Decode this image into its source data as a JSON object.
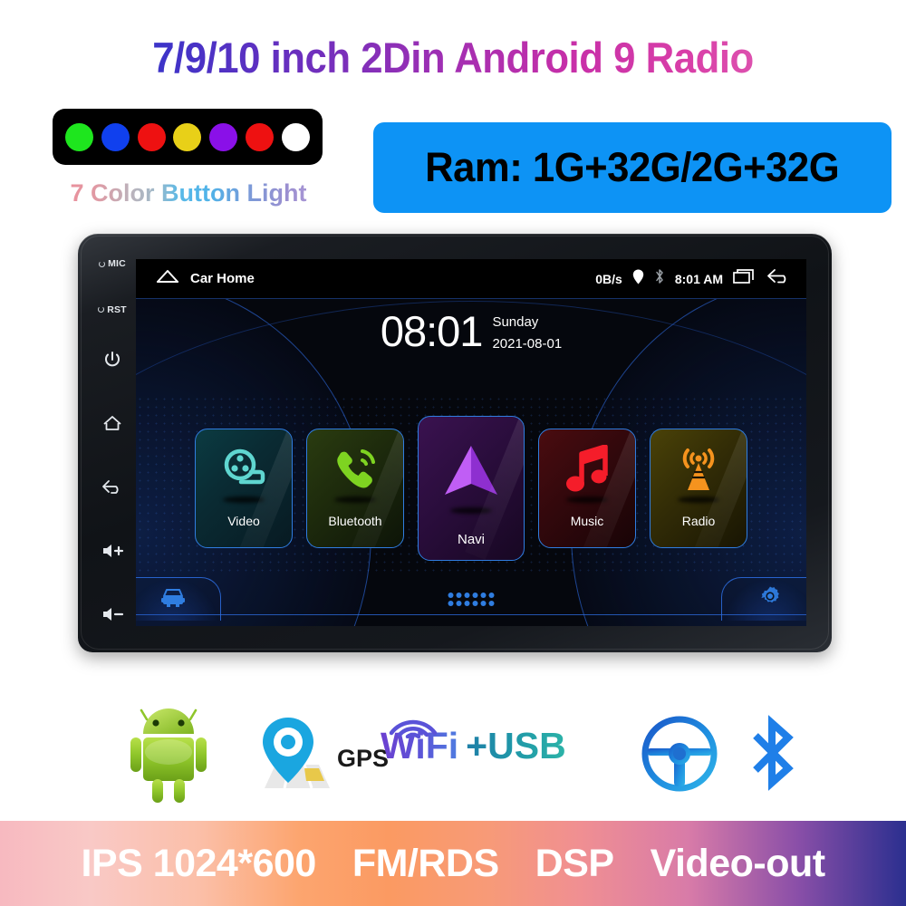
{
  "title": "7/9/10 inch 2Din Android 9 Radio",
  "light_block": {
    "caption": "7 Color Button Light",
    "dots": [
      {
        "name": "green",
        "color": "#1ee61e"
      },
      {
        "name": "blue",
        "color": "#1040ee"
      },
      {
        "name": "red",
        "color": "#ee1111"
      },
      {
        "name": "yellow",
        "color": "#e8d018"
      },
      {
        "name": "purple",
        "color": "#8a10e8"
      },
      {
        "name": "red2",
        "color": "#ee1111"
      },
      {
        "name": "white",
        "color": "#ffffff"
      }
    ]
  },
  "ram_badge": {
    "text": "Ram: 1G+32G/2G+32G",
    "bg_color": "#0d93f5",
    "text_color": "#000000"
  },
  "device": {
    "side_buttons": [
      {
        "name": "mic",
        "label": "MIC",
        "type": "label"
      },
      {
        "name": "reset",
        "label": "RST",
        "type": "label"
      },
      {
        "name": "power",
        "label": "",
        "type": "power-icon"
      },
      {
        "name": "home",
        "label": "",
        "type": "home-icon"
      },
      {
        "name": "back",
        "label": "",
        "type": "back-icon"
      },
      {
        "name": "volume-up",
        "label": "+",
        "type": "volume-icon"
      },
      {
        "name": "volume-down",
        "label": "−",
        "type": "volume-icon"
      }
    ],
    "screen": {
      "status_bar": {
        "title": "Car Home",
        "data_rate": "0B/s",
        "time": "8:01 AM"
      },
      "clock": {
        "time": "08:01",
        "weekday": "Sunday",
        "date": "2021-08-01"
      },
      "apps": [
        {
          "label": "Video",
          "icon": "film-reel-icon",
          "accent": "#5fd6d0",
          "bg": "linear-gradient(135deg,#0b3b42 0%, #0a2b33 40%, #071a22 100%)",
          "large": false
        },
        {
          "label": "Bluetooth",
          "icon": "phone-call-icon",
          "accent": "#7ed321",
          "bg": "linear-gradient(135deg,#2a3c10 0%, #1d2a0c 45%, #0d1408 100%)",
          "large": false
        },
        {
          "label": "Navi",
          "icon": "navigation-arrow-icon",
          "accent": "#b44cf0",
          "bg": "linear-gradient(135deg,#3a1250 0%, #2a0d3c 45%, #170722 100%)",
          "large": true
        },
        {
          "label": "Music",
          "icon": "music-note-icon",
          "accent": "#f51d2a",
          "bg": "linear-gradient(135deg,#4a0c10 0%, #32080c 45%, #180406 100%)",
          "large": false
        },
        {
          "label": "Radio",
          "icon": "radio-tower-icon",
          "accent": "#f5931e",
          "bg": "linear-gradient(135deg,#4a4208 0%, #322c06 45%, #181503 100%)",
          "large": false
        }
      ],
      "dock": {
        "left_icon": "car-icon",
        "center_icon": "apps-grid-icon",
        "right_icon": "gear-icon",
        "accent": "#2f7de0"
      }
    }
  },
  "features": {
    "android_icon": "android-robot-icon",
    "gps_label": "GPS",
    "gps_icon": "gps-pin-map-icon",
    "wifi_label": "WiFi",
    "usb_label": "+USB",
    "wheel_icon": "steering-wheel-icon",
    "bluetooth_icon": "bluetooth-icon"
  },
  "bottom_banner": {
    "items": [
      "IPS 1024*600",
      "FM/RDS",
      "DSP",
      "Video-out"
    ]
  }
}
